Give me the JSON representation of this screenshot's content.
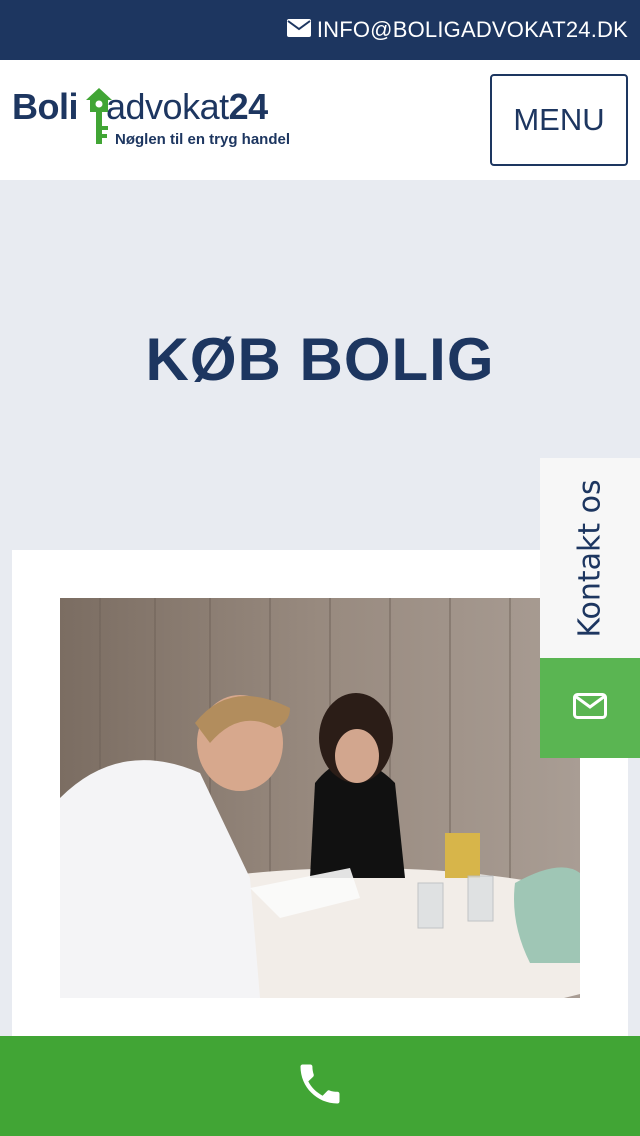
{
  "topbar": {
    "email": "INFO@BOLIGADVOKAT24.DK",
    "icon": "envelope-icon"
  },
  "header": {
    "logo": {
      "brand_part1": "Boli",
      "brand_part2": "advokat",
      "brand_part3": "24",
      "tagline": "Nøglen til en tryg handel"
    },
    "menu_label": "MENU"
  },
  "hero": {
    "title": "KØB BOLIG"
  },
  "contact_tab": {
    "label": "Kontakt os",
    "mail_icon": "envelope-icon"
  },
  "call_bar": {
    "icon": "phone-icon"
  },
  "colors": {
    "navy": "#1d3660",
    "green": "#41a535",
    "light_green": "#5ab552",
    "page_bg": "#e8ebf1"
  }
}
